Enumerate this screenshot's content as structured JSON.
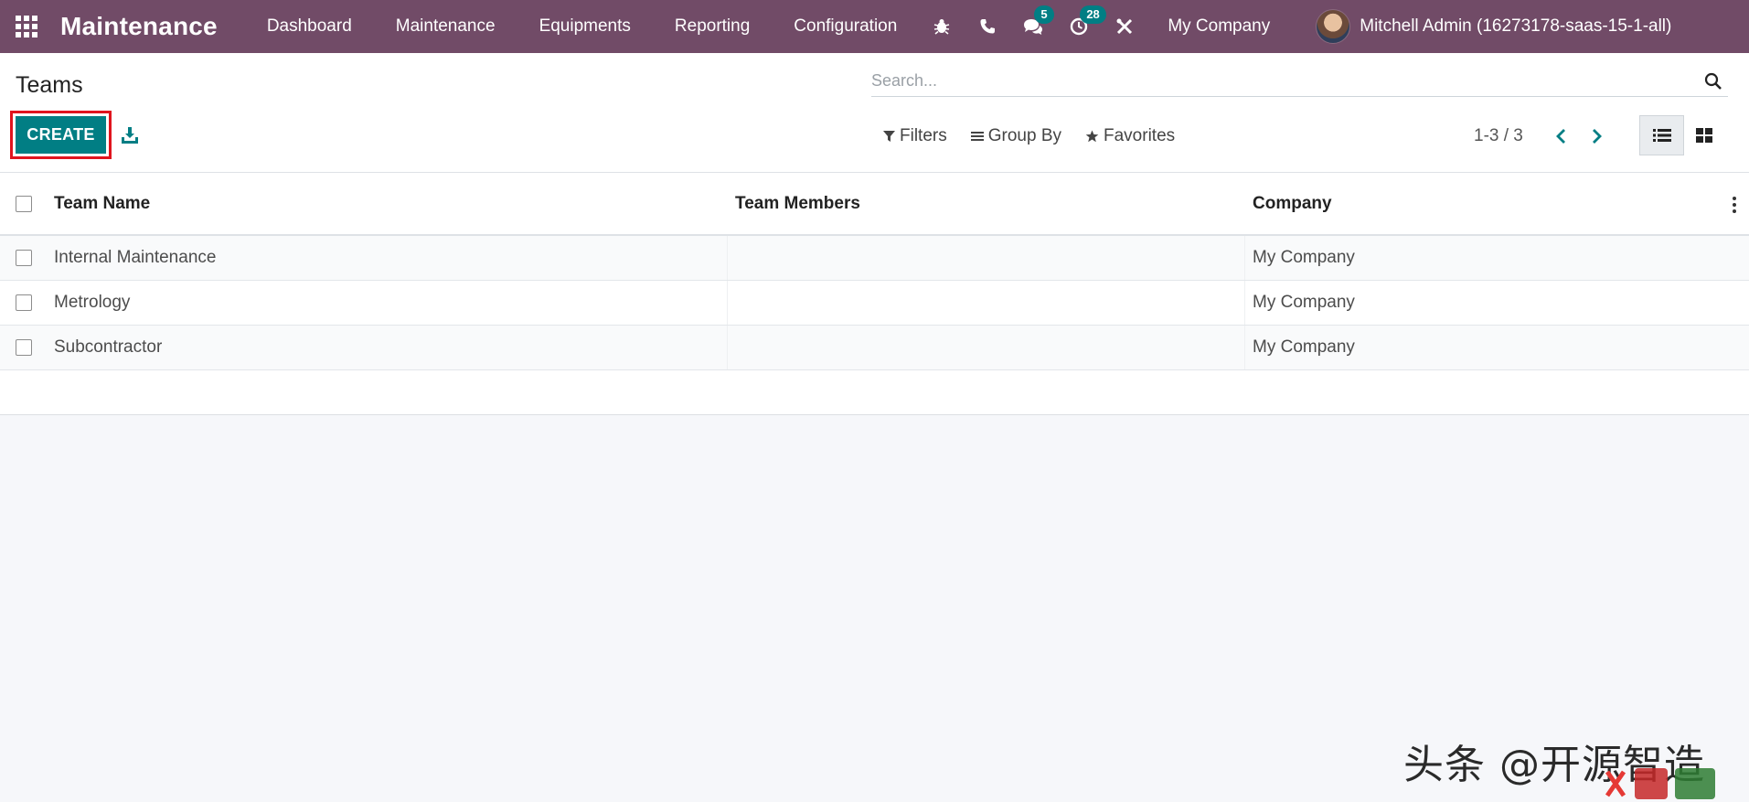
{
  "navbar": {
    "app_name": "Maintenance",
    "menu": [
      "Dashboard",
      "Maintenance",
      "Equipments",
      "Reporting",
      "Configuration"
    ],
    "messages_count": "5",
    "activities_count": "28",
    "company": "My Company",
    "user": "Mitchell Admin (16273178-saas-15-1-all)",
    "icons": [
      "apps-grid-icon",
      "bug-icon",
      "phone-icon",
      "chat-icon",
      "clock-icon",
      "tools-icon"
    ],
    "bg_color": "#714b67",
    "badge_color": "#017e84"
  },
  "control_panel": {
    "title": "Teams",
    "search_placeholder": "Search...",
    "create_label": "CREATE",
    "filters_label": "Filters",
    "groupby_label": "Group By",
    "favorites_label": "Favorites",
    "pager": "1-3 / 3",
    "primary_color": "#017e84"
  },
  "table": {
    "headers": {
      "name": "Team Name",
      "members": "Team Members",
      "company": "Company"
    },
    "rows": [
      {
        "name": "Internal Maintenance",
        "members": "",
        "company": "My Company"
      },
      {
        "name": "Metrology",
        "members": "",
        "company": "My Company"
      },
      {
        "name": "Subcontractor",
        "members": "",
        "company": "My Company"
      }
    ]
  },
  "watermark": {
    "text": "头条 @开源智造"
  }
}
